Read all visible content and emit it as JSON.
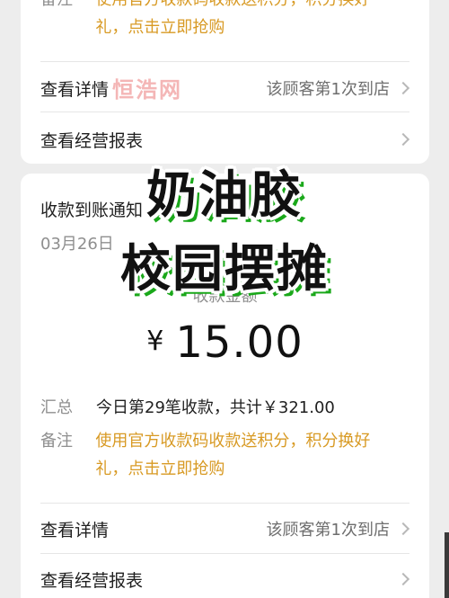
{
  "top_card": {
    "remark": {
      "label": "备注",
      "text_line1": "使用官方收款码收款送积分，积分换好",
      "text_line2": "礼，点击立即抢购"
    },
    "details": {
      "label": "查看详情",
      "right_text": "该顾客第1次到店"
    },
    "report": {
      "label": "查看经营报表"
    }
  },
  "bottom_card": {
    "title": "收款到账通知",
    "date": "03月26日",
    "amount_label": "收款金额",
    "amount_currency": "¥",
    "amount_value": "15.00",
    "summary": {
      "label": "汇总",
      "text": "今日第29笔收款，共计￥321.00"
    },
    "remark": {
      "label": "备注",
      "text_line1": "使用官方收款码收款送积分，积分换好",
      "text_line2": "礼，点击立即抢购"
    },
    "details": {
      "label": "查看详情",
      "right_text": "该顾客第1次到店"
    },
    "report": {
      "label": "查看经营报表"
    }
  },
  "overlay": {
    "line1": "奶油胶",
    "line2": "校园摆摊"
  },
  "watermark": "恒浩网",
  "colors": {
    "note": "#d89a24",
    "overlay_shadow": "#1aa81a"
  },
  "icons": {
    "chevron": "chevron-right-icon"
  }
}
